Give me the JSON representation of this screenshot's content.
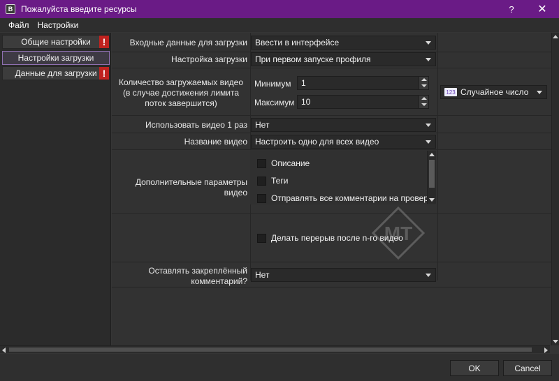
{
  "window": {
    "title": "Пожалуйста введите ресурсы",
    "help_label": "?",
    "close_label": "✕"
  },
  "menu": {
    "file": "Файл",
    "settings": "Настройки"
  },
  "sidebar": {
    "items": [
      {
        "label": "Общие настройки",
        "warning": "!"
      },
      {
        "label": "Настройки загрузки"
      },
      {
        "label": "Данные для загрузки",
        "warning": "!"
      }
    ]
  },
  "form": {
    "input_data": {
      "label": "Входные данные для загрузки",
      "value": "Ввести в интерфейсе"
    },
    "upload_setting": {
      "label": "Настройка загрузки",
      "value": "При первом запуске профиля"
    },
    "video_count": {
      "label": "Количество загружаемых видео (в случае достижения лимита поток завершится)",
      "min_label": "Минимум",
      "min_value": "1",
      "max_label": "Максимум",
      "max_value": "10",
      "random_icon": "123",
      "random_label": "Случайное число"
    },
    "use_once": {
      "label": "Использовать видео 1 раз",
      "value": "Нет"
    },
    "video_name": {
      "label": "Название видео",
      "value": "Настроить одно для всех видео"
    },
    "extra_params": {
      "label": "Дополнительные параметры видео",
      "options": [
        "Описание",
        "Теги",
        "Отправлять все комментарии на проверку"
      ]
    },
    "pause_after": {
      "label": "Делать перерыв после n-го видео"
    },
    "pinned_comment": {
      "label": "Оставлять закреплённый комментарий?",
      "value": "Нет"
    }
  },
  "watermark_text": "МТ",
  "footer": {
    "ok": "OK",
    "cancel": "Cancel"
  },
  "colors": {
    "titlebar": "#6a1b86",
    "warning": "#c0221f",
    "selected_border": "#8e6fb0"
  }
}
